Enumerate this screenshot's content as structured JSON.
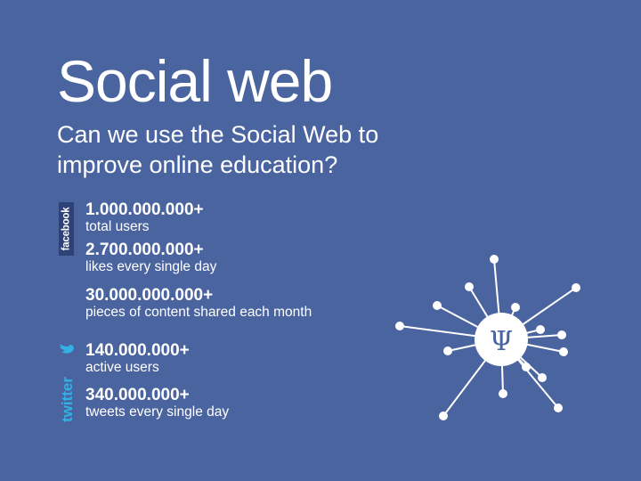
{
  "slide": {
    "title": "Social web",
    "subtitle_line1": "Can we use the Social Web to",
    "subtitle_line2": "improve online education?"
  },
  "facebook": {
    "logo_text": "facebook",
    "logo_color": "#2f4278",
    "stats": [
      {
        "value": "1.000.000.000+",
        "label": "total users"
      },
      {
        "value": "2.700.000.000+",
        "label": "likes every single day"
      },
      {
        "value": "30.000.000.000+",
        "label": "pieces of content shared each month"
      }
    ]
  },
  "twitter": {
    "logo_text": "twitter",
    "logo_color": "#33b1e5",
    "stats": [
      {
        "value": "140.000.000+",
        "label": "active users"
      },
      {
        "value": "340.000.000+",
        "label": "tweets every single day"
      }
    ]
  },
  "network_graphic": {
    "center_symbol": "Ψ",
    "color": "#ffffff"
  },
  "colors": {
    "background": "#4a64a0",
    "text": "#ffffff"
  }
}
